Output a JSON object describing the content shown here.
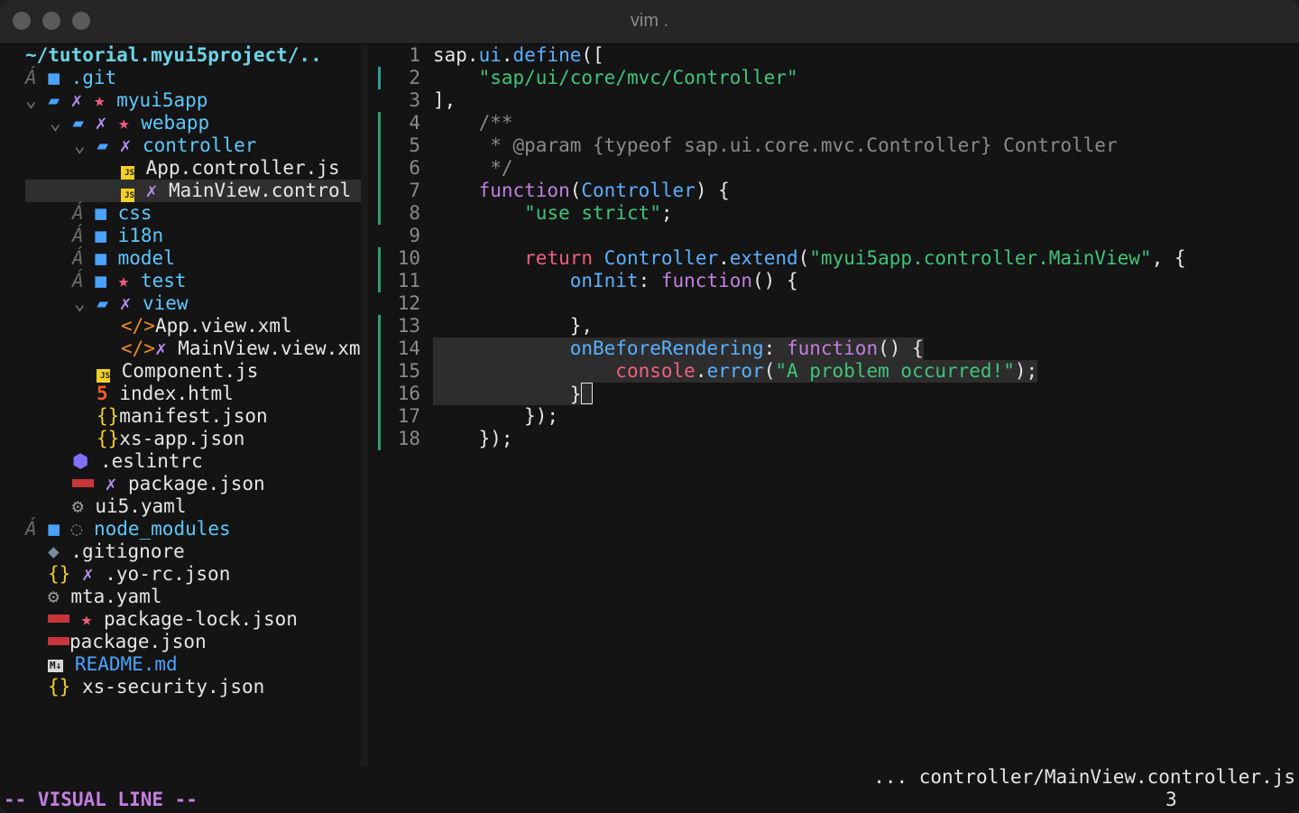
{
  "window": {
    "title": "vim ."
  },
  "tree": {
    "root": "~/tutorial.myui5project/..",
    "items": [
      {
        "name": ".git",
        "type": "folder",
        "git": "ignored"
      },
      {
        "name": "myui5app",
        "type": "folder-open",
        "marks": [
          "modified",
          "untracked"
        ]
      },
      {
        "name": "webapp",
        "type": "folder-open",
        "marks": [
          "modified",
          "untracked"
        ]
      },
      {
        "name": "controller",
        "type": "folder-open",
        "marks": [
          "modified"
        ]
      },
      {
        "name": "App.controller.js",
        "type": "js"
      },
      {
        "name": "MainView.control",
        "type": "js",
        "marks": [
          "modified"
        ],
        "selected": true
      },
      {
        "name": "css",
        "type": "folder",
        "git": "ignored"
      },
      {
        "name": "i18n",
        "type": "folder",
        "git": "ignored"
      },
      {
        "name": "model",
        "type": "folder",
        "git": "ignored"
      },
      {
        "name": "test",
        "type": "folder",
        "git": "ignored",
        "marks": [
          "untracked"
        ]
      },
      {
        "name": "view",
        "type": "folder-open",
        "marks": [
          "modified"
        ]
      },
      {
        "name": "App.view.xml",
        "type": "xml"
      },
      {
        "name": "MainView.view.xm",
        "type": "xml",
        "marks": [
          "modified"
        ]
      },
      {
        "name": "Component.js",
        "type": "js"
      },
      {
        "name": "index.html",
        "type": "html"
      },
      {
        "name": "manifest.json",
        "type": "json"
      },
      {
        "name": "xs-app.json",
        "type": "json"
      },
      {
        "name": ".eslintrc",
        "type": "eslint"
      },
      {
        "name": "package.json",
        "type": "npm",
        "marks": [
          "modified"
        ]
      },
      {
        "name": "ui5.yaml",
        "type": "gear"
      },
      {
        "name": "node_modules",
        "type": "folder",
        "git": "ignored"
      },
      {
        "name": ".gitignore",
        "type": "gitignore"
      },
      {
        "name": ".yo-rc.json",
        "type": "json",
        "marks": [
          "modified"
        ]
      },
      {
        "name": "mta.yaml",
        "type": "gear"
      },
      {
        "name": "package-lock.json",
        "type": "npm",
        "marks": [
          "untracked"
        ]
      },
      {
        "name": "package.json",
        "type": "npm"
      },
      {
        "name": "README.md",
        "type": "md"
      },
      {
        "name": "xs-security.json",
        "type": "json"
      }
    ]
  },
  "editor": {
    "lines": [
      {
        "n": "1",
        "text": "sap.ui.define(["
      },
      {
        "n": "2",
        "text": "    \"sap/ui/core/mvc/Controller\""
      },
      {
        "n": "3",
        "text": "],"
      },
      {
        "n": "4",
        "text": "    /**"
      },
      {
        "n": "5",
        "text": "     * @param {typeof sap.ui.core.mvc.Controller} Controller"
      },
      {
        "n": "6",
        "text": "     */"
      },
      {
        "n": "7",
        "text": "    function(Controller) {"
      },
      {
        "n": "8",
        "text": "        \"use strict\";"
      },
      {
        "n": "9",
        "text": ""
      },
      {
        "n": "10",
        "text": "        return Controller.extend(\"myui5app.controller.MainView\", {"
      },
      {
        "n": "11",
        "text": "            onInit: function() {"
      },
      {
        "n": "12",
        "text": ""
      },
      {
        "n": "13",
        "text": "            },"
      },
      {
        "n": "14",
        "text": "            onBeforeRendering: function() {"
      },
      {
        "n": "15",
        "text": "                console.error(\"A problem occurred!\");"
      },
      {
        "n": "16",
        "text": "            }"
      },
      {
        "n": "17",
        "text": "        });"
      },
      {
        "n": "18",
        "text": "    });"
      }
    ]
  },
  "status": {
    "file": "... controller/MainView.controller.js",
    "mode": "-- VISUAL LINE --",
    "selected_lines": "3"
  },
  "colors": {
    "accent_green": "#3fc47a",
    "keyword": "#c47fe0",
    "function": "#5ab0ff",
    "return": "#f0607d"
  }
}
